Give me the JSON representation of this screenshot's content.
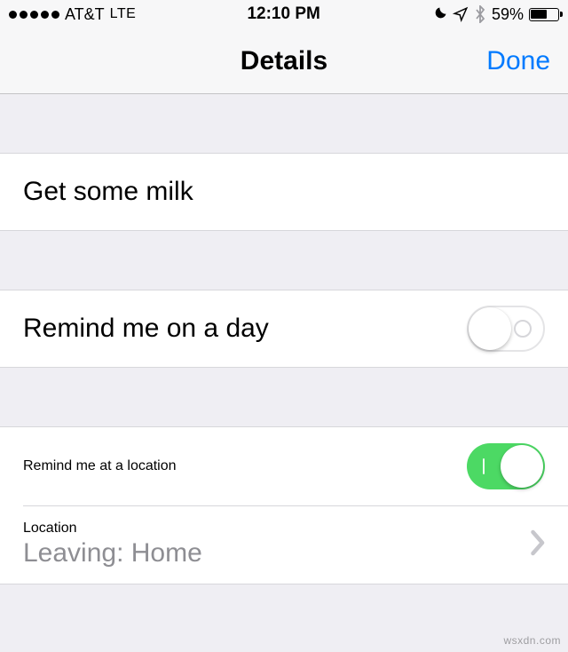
{
  "status": {
    "carrier": "AT&T",
    "network": "LTE",
    "time": "12:10 PM",
    "battery_pct": "59%",
    "battery_fill_pct": 59
  },
  "nav": {
    "title": "Details",
    "done": "Done"
  },
  "reminder": {
    "title": "Get some milk"
  },
  "day": {
    "label": "Remind me on a day",
    "enabled": false
  },
  "location": {
    "label": "Remind me at a location",
    "enabled": true,
    "row_label": "Location",
    "row_sub": "Leaving: Home"
  },
  "watermark": "wsxdn.com"
}
